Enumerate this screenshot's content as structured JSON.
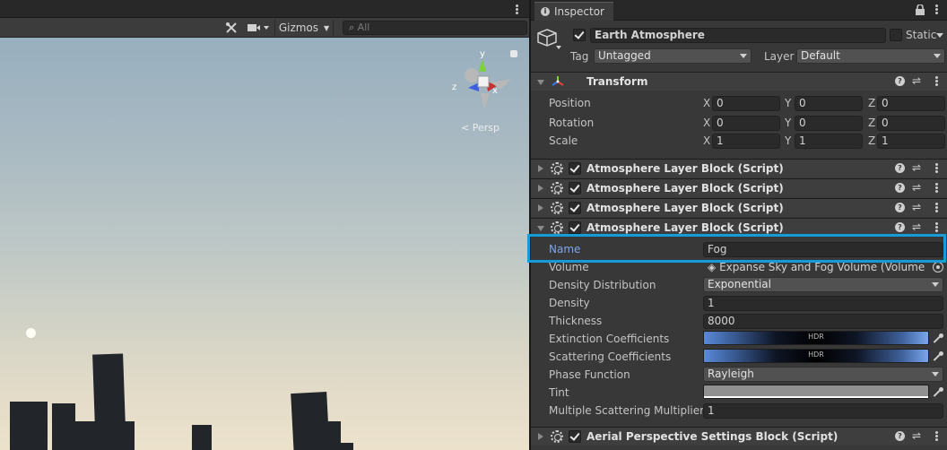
{
  "scene": {
    "gizmos_label": "Gizmos",
    "search_placeholder": "All",
    "persp_label": "Persp",
    "gizmo_axes": {
      "x": "x",
      "y": "y",
      "z": "z"
    },
    "colors": {
      "sky_top": "#98afbf",
      "sky_horizon": "#ece2cc",
      "buildings": "#22252a"
    }
  },
  "inspector": {
    "tab_label": "Inspector",
    "object": {
      "name": "Earth Atmosphere",
      "active": true,
      "static_label": "Static",
      "tag_label": "Tag",
      "tag_value": "Untagged",
      "layer_label": "Layer",
      "layer_value": "Default"
    },
    "transform": {
      "title": "Transform",
      "rows": [
        {
          "label": "Position",
          "x": "0",
          "y": "0",
          "z": "0"
        },
        {
          "label": "Rotation",
          "x": "0",
          "y": "0",
          "z": "0"
        },
        {
          "label": "Scale",
          "x": "1",
          "y": "1",
          "z": "1"
        }
      ],
      "axis_x": "X",
      "axis_y": "Y",
      "axis_z": "Z"
    },
    "components": [
      {
        "title": "Atmosphere Layer Block (Script)",
        "enabled": true,
        "expanded": false
      },
      {
        "title": "Atmosphere Layer Block (Script)",
        "enabled": true,
        "expanded": false
      },
      {
        "title": "Atmosphere Layer Block (Script)",
        "enabled": true,
        "expanded": false
      },
      {
        "title": "Atmosphere Layer Block (Script)",
        "enabled": true,
        "expanded": true
      }
    ],
    "layer_block": {
      "name_label": "Name",
      "name_value": "Fog",
      "volume_label": "Volume",
      "volume_value": "Expanse Sky and Fog Volume (Volume)",
      "density_distribution_label": "Density Distribution",
      "density_distribution_value": "Exponential",
      "density_label": "Density",
      "density_value": "1",
      "thickness_label": "Thickness",
      "thickness_value": "8000",
      "extinction_label": "Extinction Coefficients",
      "extinction_hdr": "HDR",
      "scattering_label": "Scattering Coefficients",
      "scattering_hdr": "HDR",
      "phase_label": "Phase Function",
      "phase_value": "Rayleigh",
      "tint_label": "Tint",
      "multiple_scattering_label": "Multiple Scattering Multiplier",
      "multiple_scattering_value": "1"
    },
    "last_component": {
      "title": "Aerial Perspective Settings Block (Script)",
      "enabled": true,
      "expanded": false
    },
    "colors": {
      "highlight": "#159bd6",
      "name_label": "#7da6e8",
      "tint": "#909090"
    }
  }
}
